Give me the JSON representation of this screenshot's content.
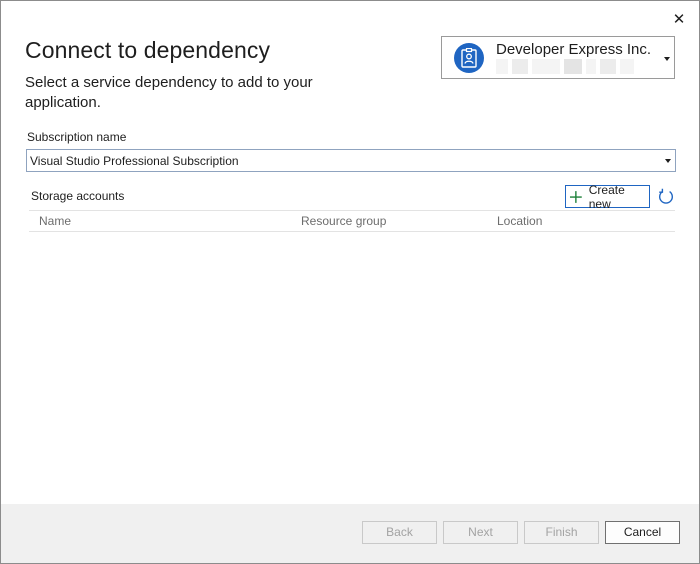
{
  "window": {
    "close_glyph": "✕"
  },
  "header": {
    "title": "Connect to dependency",
    "subtitle": "Select a service dependency to add to your application."
  },
  "account": {
    "name": "Developer Express Inc.",
    "icon": "account-badge-icon",
    "accent": "#1f65c2"
  },
  "subscription": {
    "label": "Subscription name",
    "value": "Visual Studio Professional Subscription"
  },
  "storage": {
    "label": "Storage accounts",
    "create_label": "Create new",
    "columns": [
      "Name",
      "Resource group",
      "Location"
    ],
    "rows": []
  },
  "footer": {
    "back": "Back",
    "next": "Next",
    "finish": "Finish",
    "cancel": "Cancel"
  }
}
